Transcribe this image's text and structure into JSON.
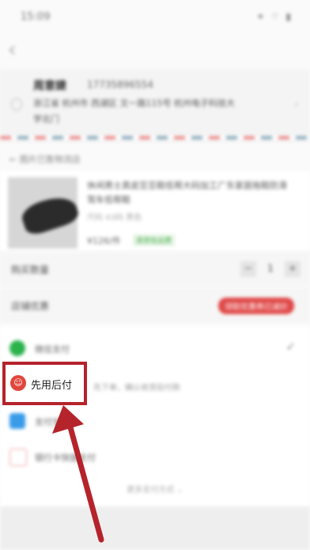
{
  "status_bar": {
    "time": "15:09",
    "signal_icons": "✦ ⌔ ▮"
  },
  "address": {
    "name": "周意婕",
    "phone": "17735896554",
    "line1": "浙江省 杭州市 西湖区 文一路115号 杭州电子科技大",
    "line2": "学北门"
  },
  "shipping_label": "图片已售物流店",
  "product": {
    "title": "休闲男士真皮豆豆鞋低帮大码加工广东家居拖鞋防滑驾车低帮鞋",
    "sku": "尺码 43码  黑色",
    "price": "¥126/件",
    "tag": "退货包运费"
  },
  "quantity": {
    "label": "购买数量",
    "minus": "−",
    "value": "1",
    "plus": "+"
  },
  "store_coupon": {
    "label": "店铺优惠",
    "value": "领取优惠券已减价"
  },
  "payment": {
    "wechat_label": "微信支付",
    "pay_later_label": "先用后付",
    "pay_later_desc": "先下单，确认收货后付款",
    "alipay_label": "支付宝",
    "card_label": "银行卡快捷支付",
    "more_label": "更多支付方式 ⌄"
  },
  "colors": {
    "highlight_border": "#b5232b",
    "arrow": "#b5232b",
    "badge": "#e0463c",
    "wechat": "#2bb24c",
    "alipay": "#3a9be8",
    "coupon": "#e04848"
  }
}
